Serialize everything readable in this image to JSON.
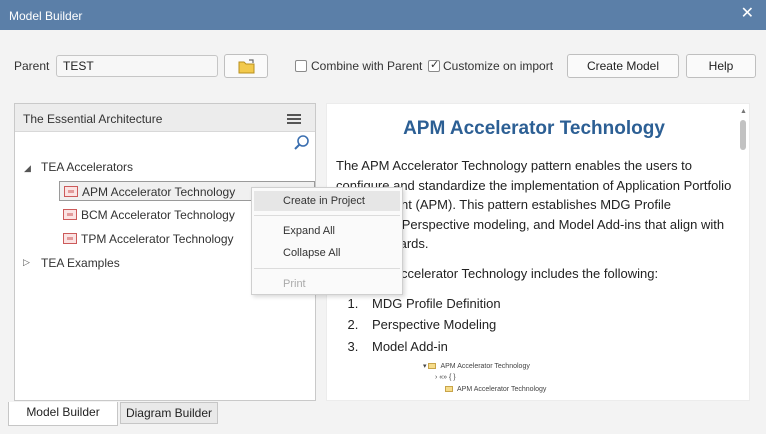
{
  "window": {
    "title": "Model Builder"
  },
  "toolbar": {
    "parent_label": "Parent",
    "parent_value": "TEST",
    "combine_label": "Combine with Parent",
    "combine_checked": false,
    "customize_label": "Customize on import",
    "customize_checked": true,
    "create_model_label": "Create Model",
    "help_label": "Help"
  },
  "tree": {
    "header": "The Essential Architecture",
    "nodes": [
      {
        "label": "TEA Accelerators",
        "expanded": true
      },
      {
        "label": "TEA Examples",
        "expanded": false
      }
    ],
    "items": [
      {
        "label": "APM Accelerator Technology",
        "selected": true
      },
      {
        "label": "BCM Accelerator Technology",
        "selected": false
      },
      {
        "label": "TPM Accelerator Technology",
        "selected": false
      }
    ]
  },
  "context_menu": {
    "items": [
      {
        "label": "Create in Project",
        "highlighted": true,
        "disabled": false
      },
      {
        "label": "Expand All",
        "highlighted": false,
        "disabled": false
      },
      {
        "label": "Collapse All",
        "highlighted": false,
        "disabled": false
      },
      {
        "label": "Print",
        "highlighted": false,
        "disabled": true
      }
    ]
  },
  "detail": {
    "title": "APM Accelerator Technology",
    "paragraph1": "The APM Accelerator Technology pattern enables the users to configure and standardize the implementation of Application Portfolio Management (APM). This pattern establishes MDG Profile definitions, Perspective modeling, and Model Add-ins that align with APM standards.",
    "paragraph2": "The APM Accelerator Technology includes the following:",
    "list": [
      "MDG Profile Definition",
      "Perspective Modeling",
      "Model Add-in"
    ],
    "preview_lines": [
      "APM Accelerator Technology",
      "«» { }",
      "APM Accelerator Technology"
    ]
  },
  "tabs": [
    {
      "label": "Model Builder",
      "active": true
    },
    {
      "label": "Diagram Builder",
      "active": false
    }
  ]
}
